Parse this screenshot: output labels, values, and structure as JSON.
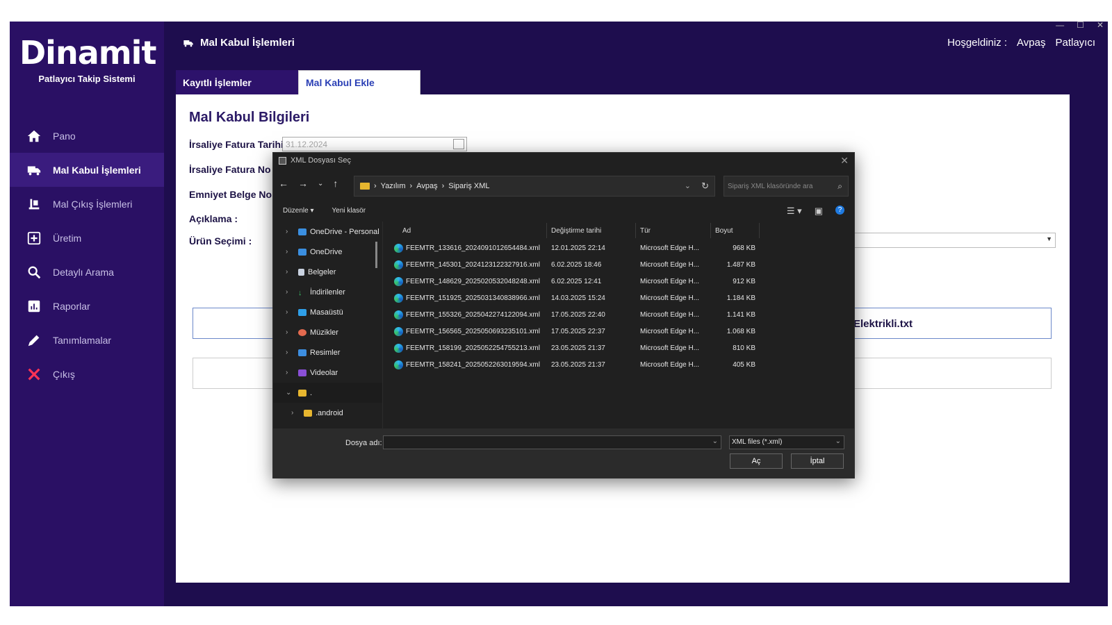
{
  "app": {
    "logo": "Dinamit",
    "subtitle": "Patlayıcı Takip Sistemi",
    "header_title": "Mal Kabul İşlemleri",
    "welcome": "Hoşgeldiniz :",
    "user": "Avpaş",
    "user2": "Patlayıcı"
  },
  "sidebar": {
    "items": [
      {
        "label": "Pano"
      },
      {
        "label": "Mal Kabul İşlemleri"
      },
      {
        "label": "Mal Çıkış İşlemleri"
      },
      {
        "label": "Üretim"
      },
      {
        "label": "Detaylı Arama"
      },
      {
        "label": "Raporlar"
      },
      {
        "label": "Tanımlamalar"
      },
      {
        "label": "Çıkış"
      }
    ]
  },
  "tabs": [
    "Kayıtlı İşlemler",
    "Mal Kabul Ekle"
  ],
  "form": {
    "title": "Mal Kabul Bilgileri",
    "labels": [
      "İrsaliye Fatura Tarihi :",
      "İrsaliye Fatura No :",
      "Emniyet Belge No :",
      "Açıklama :",
      "Ürün Seçimi :"
    ],
    "date_value": "31.12.2024",
    "file_text": "Elektrikli.txt"
  },
  "dialog": {
    "title": "XML Dosyası Seç",
    "breadcrumb": [
      "Yazılım",
      "Avpaş",
      "Sipariş XML"
    ],
    "search_placeholder": "Sipariş XML klasöründe ara",
    "toolbar": [
      "Düzenle",
      "Yeni klasör"
    ],
    "tree": [
      "OneDrive - Personal",
      "OneDrive",
      "Belgeler",
      "İndirilenler",
      "Masaüstü",
      "Müzikler",
      "Resimler",
      "Videolar",
      ".",
      ".android"
    ],
    "columns": [
      "Ad",
      "Değiştirme tarihi",
      "Tür",
      "Boyut"
    ],
    "files": [
      {
        "name": "FEEMTR_133616_2024091012654484.xml",
        "date": "12.01.2025 22:14",
        "type": "Microsoft Edge H...",
        "size": "968 KB"
      },
      {
        "name": "FEEMTR_145301_2024123122327916.xml",
        "date": "6.02.2025 18:46",
        "type": "Microsoft Edge H...",
        "size": "1.487 KB"
      },
      {
        "name": "FEEMTR_148629_2025020532048248.xml",
        "date": "6.02.2025 12:41",
        "type": "Microsoft Edge H...",
        "size": "912 KB"
      },
      {
        "name": "FEEMTR_151925_2025031340838966.xml",
        "date": "14.03.2025 15:24",
        "type": "Microsoft Edge H...",
        "size": "1.184 KB"
      },
      {
        "name": "FEEMTR_155326_2025042274122094.xml",
        "date": "17.05.2025 22:40",
        "type": "Microsoft Edge H...",
        "size": "1.141 KB"
      },
      {
        "name": "FEEMTR_156565_2025050693235101.xml",
        "date": "17.05.2025 22:37",
        "type": "Microsoft Edge H...",
        "size": "1.068 KB"
      },
      {
        "name": "FEEMTR_158199_2025052254755213.xml",
        "date": "23.05.2025 21:37",
        "type": "Microsoft Edge H...",
        "size": "810 KB"
      },
      {
        "name": "FEEMTR_158241_2025052263019594.xml",
        "date": "23.05.2025 21:37",
        "type": "Microsoft Edge H...",
        "size": "405 KB"
      }
    ],
    "filename_label": "Dosya adı:",
    "filetype": "XML files (*.xml)",
    "open": "Aç",
    "cancel": "İptal"
  }
}
